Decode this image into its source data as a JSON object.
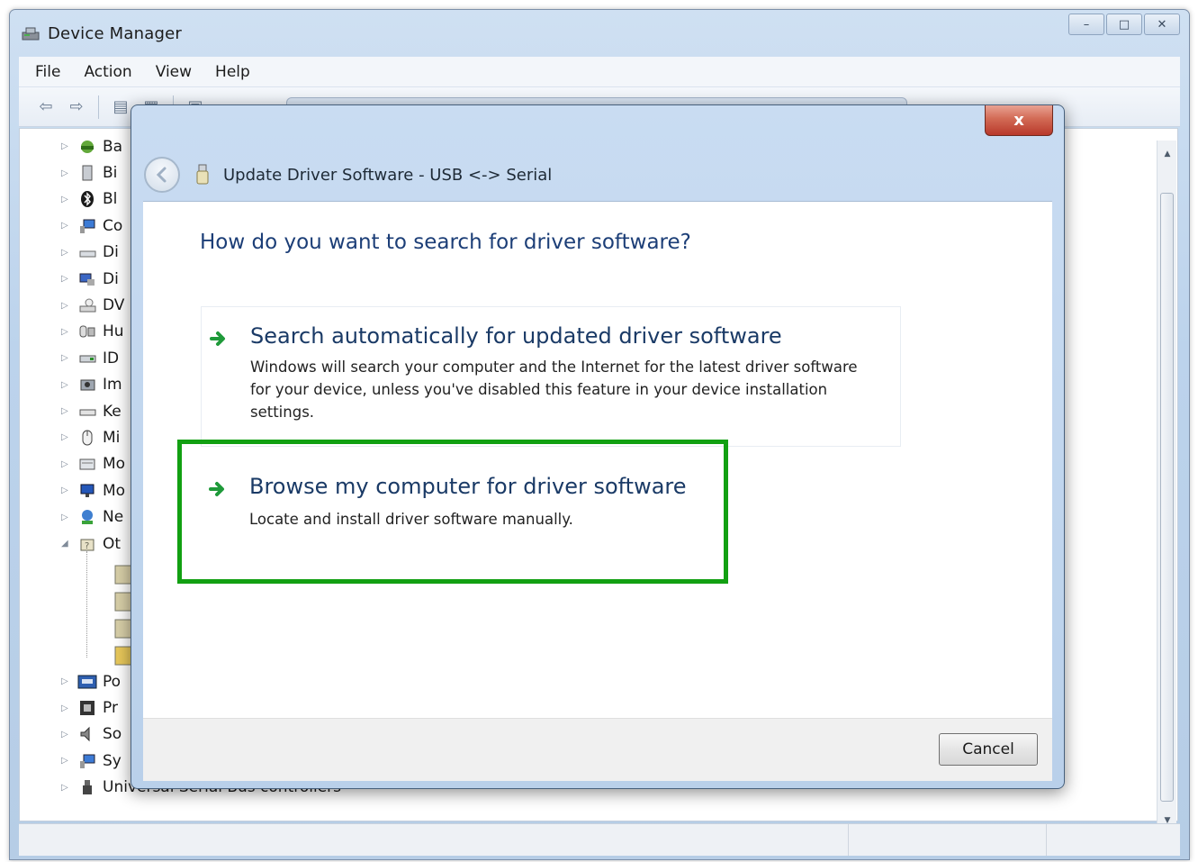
{
  "device_manager": {
    "title": "Device Manager",
    "menu": [
      "File",
      "Action",
      "View",
      "Help"
    ],
    "tree": [
      {
        "label": "Ba",
        "icon": "battery-icon",
        "expanded": false
      },
      {
        "label": "Bi",
        "icon": "biometric-icon",
        "expanded": false
      },
      {
        "label": "Bl",
        "icon": "bluetooth-icon",
        "expanded": false
      },
      {
        "label": "Co",
        "icon": "computer-icon",
        "expanded": false
      },
      {
        "label": "Di",
        "icon": "disk-drive-icon",
        "expanded": false
      },
      {
        "label": "Di",
        "icon": "display-adapter-icon",
        "expanded": false
      },
      {
        "label": "DV",
        "icon": "dvd-drive-icon",
        "expanded": false
      },
      {
        "label": "Hu",
        "icon": "hid-icon",
        "expanded": false
      },
      {
        "label": "ID",
        "icon": "ide-controller-icon",
        "expanded": false
      },
      {
        "label": "Im",
        "icon": "imaging-device-icon",
        "expanded": false
      },
      {
        "label": "Ke",
        "icon": "keyboard-icon",
        "expanded": false
      },
      {
        "label": "Mi",
        "icon": "mouse-icon",
        "expanded": false
      },
      {
        "label": "Mo",
        "icon": "modem-icon",
        "expanded": false
      },
      {
        "label": "Mo",
        "icon": "monitor-icon",
        "expanded": false
      },
      {
        "label": "Ne",
        "icon": "network-adapter-icon",
        "expanded": false
      },
      {
        "label": "Ot",
        "icon": "other-devices-icon",
        "expanded": true
      }
    ],
    "tree_bottom": [
      {
        "label": "Po",
        "icon": "ports-icon"
      },
      {
        "label": "Pr",
        "icon": "processor-icon"
      },
      {
        "label": "So",
        "icon": "sound-icon"
      },
      {
        "label": "Sy",
        "icon": "system-devices-icon"
      }
    ],
    "tree_last_label": "Universal Serial Bus controllers"
  },
  "dialog": {
    "title": "Update Driver Software - USB <-> Serial",
    "close_label": "x",
    "question": "How do you want to search for driver software?",
    "option_auto": {
      "title": "Search automatically for updated driver software",
      "description_lines": [
        "Windows will search your computer and the Internet for the latest driver software",
        "for your device, unless you've disabled this feature in your device installation",
        "settings."
      ]
    },
    "option_browse": {
      "title": "Browse my computer for driver software",
      "description": "Locate and install driver software manually."
    },
    "cancel_label": "Cancel",
    "highlight_color": "#12a012",
    "accent_color": "#1c3e77"
  }
}
